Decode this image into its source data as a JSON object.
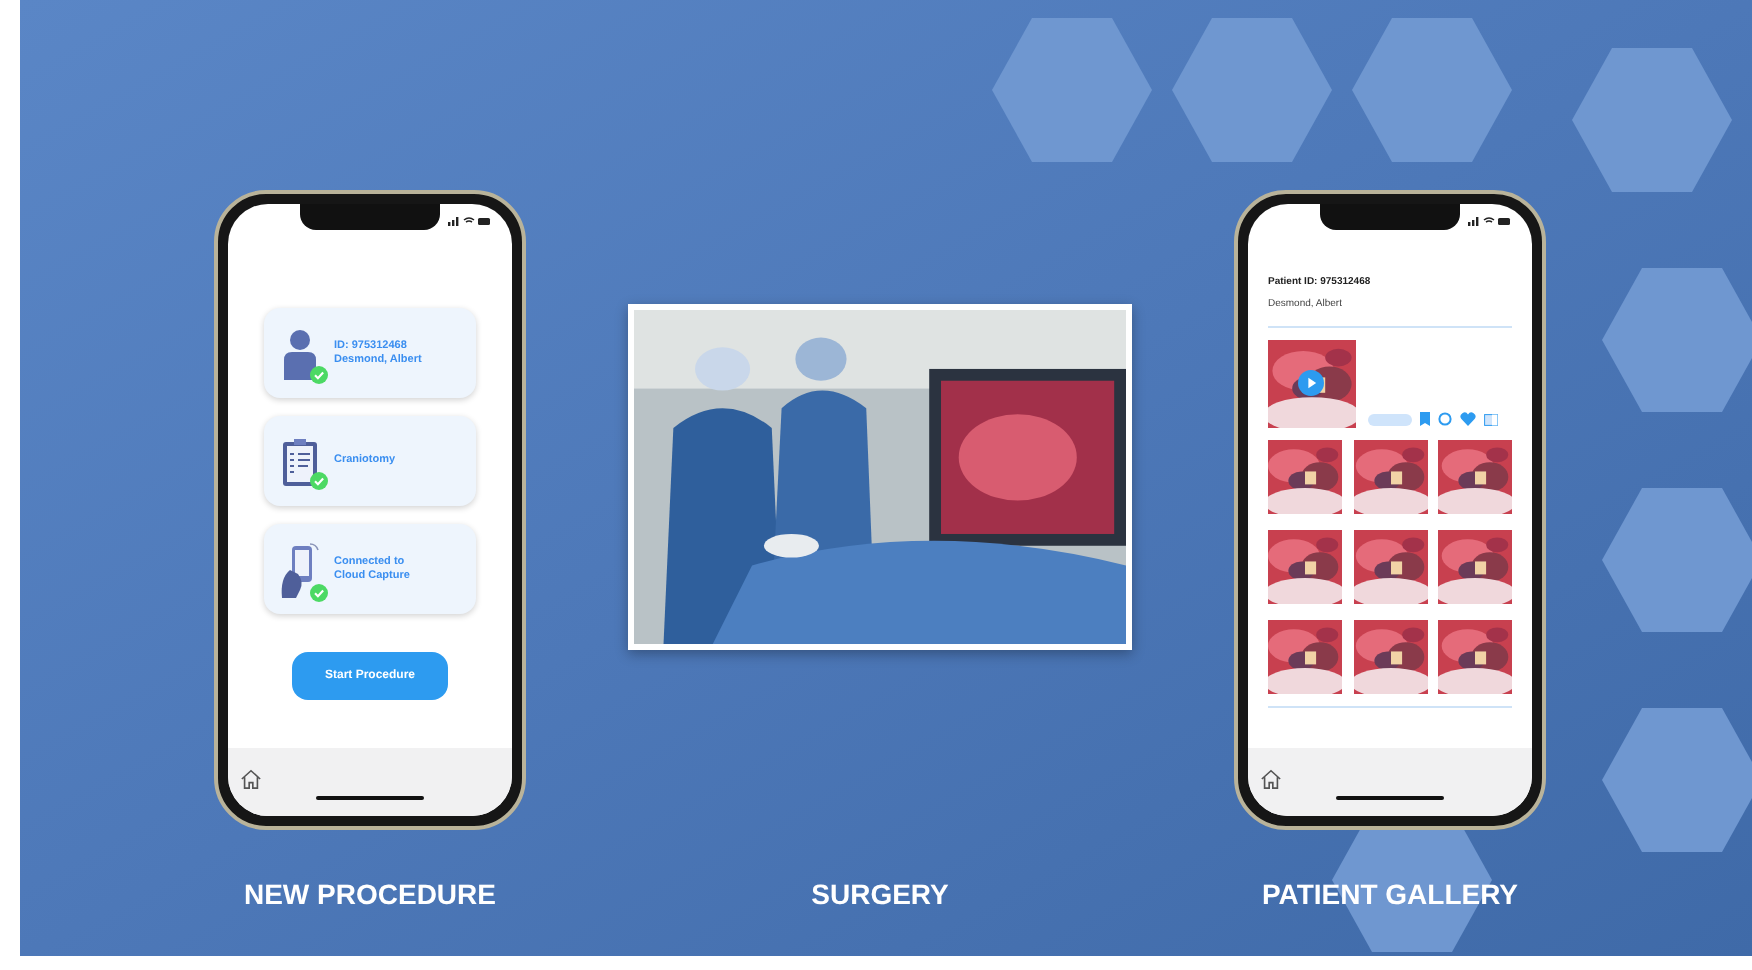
{
  "new_procedure": {
    "status_cards": [
      {
        "kind": "patient",
        "lines": [
          "ID: 975312468",
          "Desmond, Albert"
        ],
        "done": true
      },
      {
        "kind": "procedure",
        "lines": [
          "Craniotomy"
        ],
        "done": true
      },
      {
        "kind": "device",
        "lines": [
          "Connected to",
          "Cloud Capture"
        ],
        "done": true
      }
    ],
    "button": "Start Procedure",
    "caption": "NEW PROCEDURE"
  },
  "surgery": {
    "caption": "SURGERY"
  },
  "patient_gallery": {
    "patient_id": "Patient ID: 975312468",
    "name": "Desmond, Albert",
    "caption": "PATIENT GALLERY"
  }
}
